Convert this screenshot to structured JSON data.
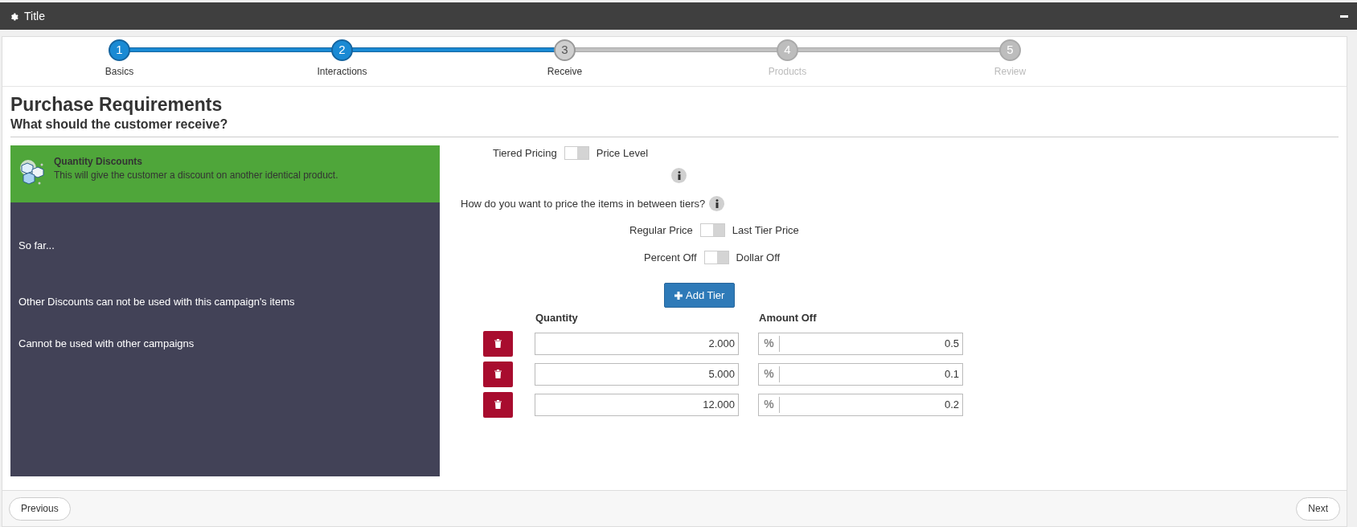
{
  "window": {
    "title": "Title"
  },
  "steps": [
    {
      "number": "1",
      "label": "Basics",
      "completed": true,
      "selected": false
    },
    {
      "number": "2",
      "label": "Interactions",
      "completed": true,
      "selected": false
    },
    {
      "number": "3",
      "label": "Receive",
      "completed": false,
      "selected": true
    },
    {
      "number": "4",
      "label": "Products",
      "completed": false,
      "selected": false
    },
    {
      "number": "5",
      "label": "Review",
      "completed": false,
      "selected": false
    }
  ],
  "heading": "Purchase Requirements",
  "subheading": "What should the customer receive?",
  "summary_card": {
    "title": "Quantity Discounts",
    "description": "This will give the customer a discount on another identical product.",
    "lines": [
      "So far...",
      "Other Discounts can not be used with this campaign's items",
      "Cannot be used with other campaigns"
    ]
  },
  "pricing_toggle": {
    "left": "Tiered Pricing",
    "right": "Price Level",
    "on": false
  },
  "between_tiers_question": "How do you want to price the items in between tiers?",
  "toggles": [
    {
      "left": "Regular Price",
      "right": "Last Tier Price",
      "on": false
    },
    {
      "left": "Percent Off",
      "right": "Dollar Off",
      "on": false
    }
  ],
  "add_tier_button": "Add Tier",
  "tiers": {
    "columns": [
      "Quantity",
      "Amount Off"
    ],
    "unit": "%",
    "rows": [
      {
        "quantity": "2.000",
        "amount": "0.5"
      },
      {
        "quantity": "5.000",
        "amount": "0.1"
      },
      {
        "quantity": "12.000",
        "amount": "0.2"
      }
    ]
  },
  "footer": {
    "previous": "Previous",
    "next": "Next"
  }
}
